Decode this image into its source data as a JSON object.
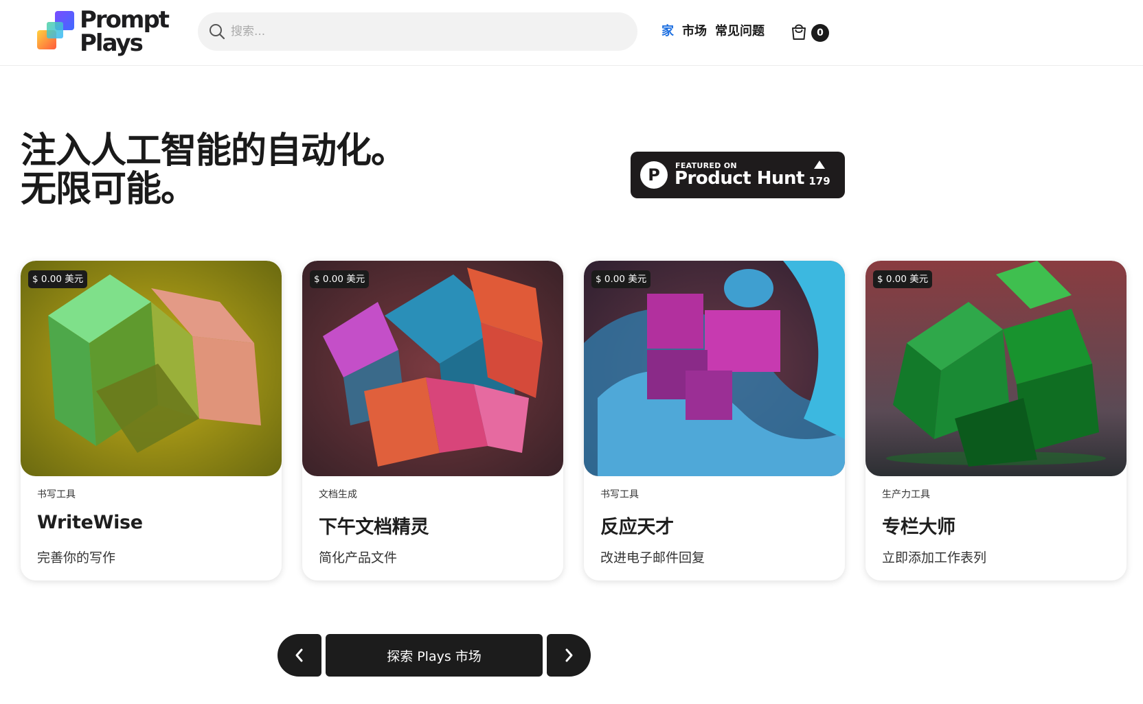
{
  "header": {
    "logo_line1": "Prompt",
    "logo_line2": "Plays",
    "search_placeholder": "搜索...",
    "nav": [
      {
        "label": "家",
        "active": true
      },
      {
        "label": "市场",
        "active": false
      },
      {
        "label": "常见问题",
        "active": false
      }
    ],
    "cart_count": "0",
    "accent_color": "#1d6fe0"
  },
  "hero": {
    "line1": "注入人工智能的自动化。",
    "line2": "无限可能。"
  },
  "product_hunt": {
    "featured_label": "FEATURED ON",
    "name": "Product Hunt",
    "logo_letter": "P",
    "upvotes": "179"
  },
  "cards": [
    {
      "price": "$ 0.00 美元",
      "category": "书写工具",
      "title": "WriteWise",
      "description": "完善你的写作",
      "image": "green-cube-abstract"
    },
    {
      "price": "$ 0.00 美元",
      "category": "文档生成",
      "title": "下午文档精灵",
      "description": "简化产品文件",
      "image": "blue-pink-cube-abstract"
    },
    {
      "price": "$ 0.00 美元",
      "category": "书写工具",
      "title": "反应天才",
      "description": "改进电子邮件回复",
      "image": "blue-magenta-swirl-abstract"
    },
    {
      "price": "$ 0.00 美元",
      "category": "生产力工具",
      "title": "专栏大师",
      "description": "立即添加工作表列",
      "image": "green-cube-cluster-abstract"
    }
  ],
  "pager": {
    "main_label": "探索 Plays 市场",
    "prev_icon": "chevron-left-icon",
    "next_icon": "chevron-right-icon"
  }
}
